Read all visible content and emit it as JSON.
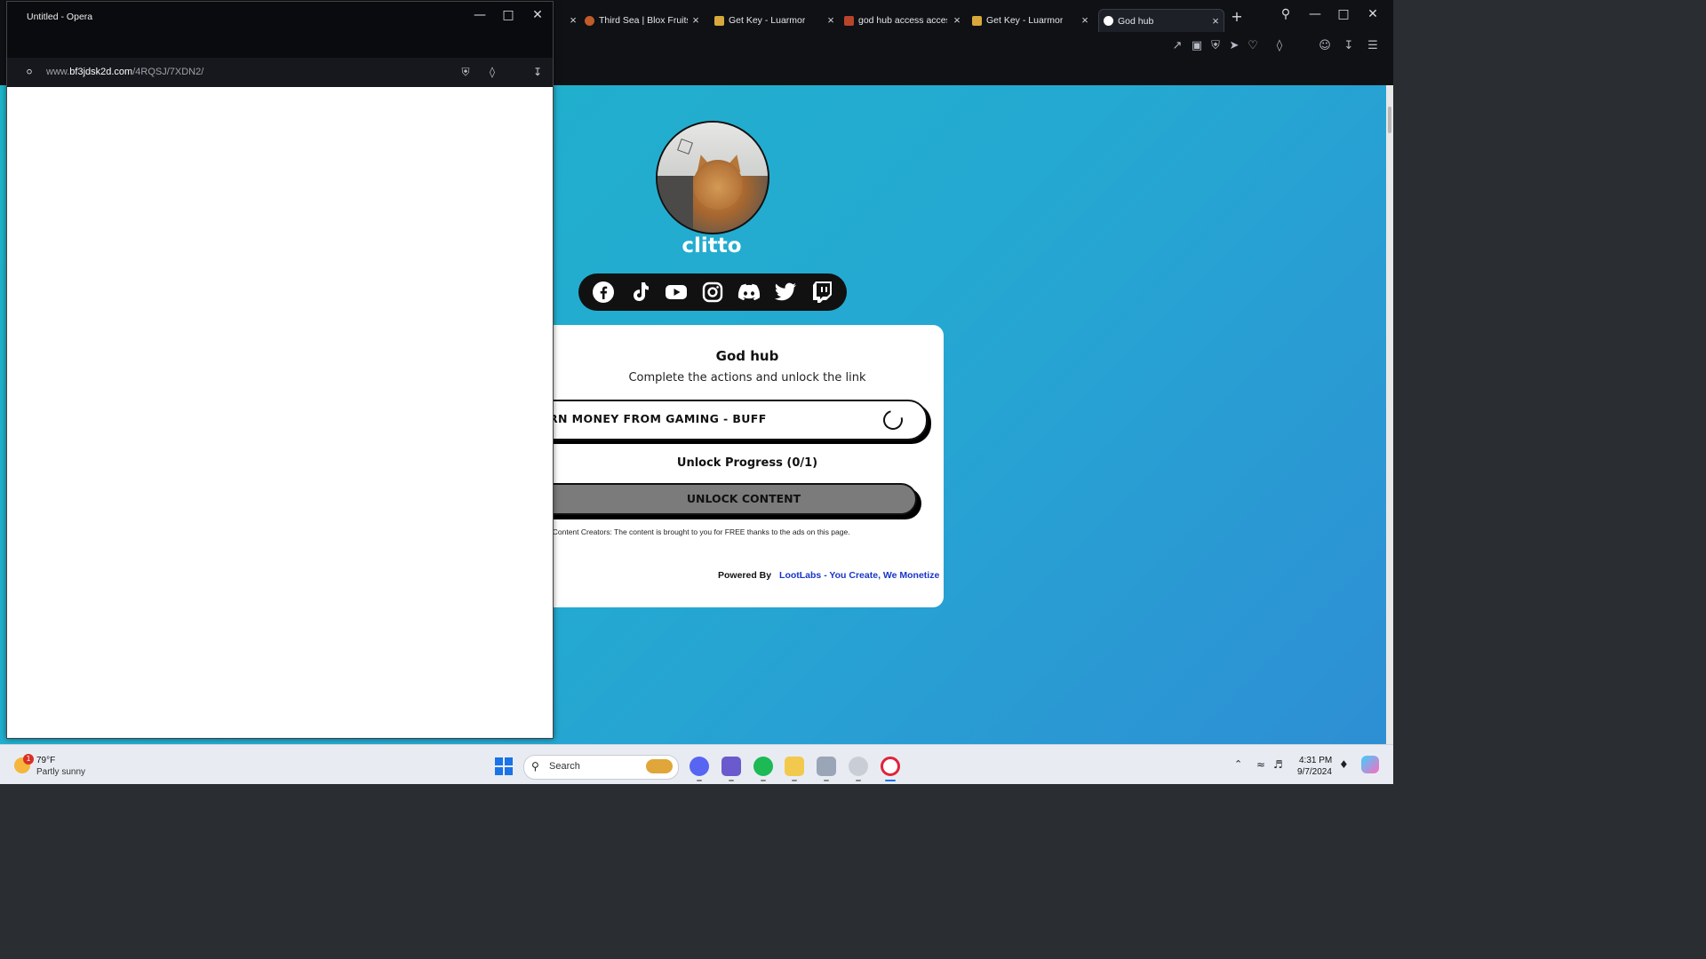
{
  "main_window": {
    "tabs": [
      {
        "label": "",
        "favicon_color": "#5a5e66"
      },
      {
        "label": "Third Sea | Blox Fruits V",
        "favicon_color": "#c25b2a"
      },
      {
        "label": "Get Key - Luarmor",
        "favicon_color": "#d9a83a"
      },
      {
        "label": "god hub access access",
        "favicon_color": "#b8442a"
      },
      {
        "label": "Get Key - Luarmor",
        "favicon_color": "#d9a83a"
      },
      {
        "label": "God hub",
        "favicon_color": "#ffffff"
      }
    ],
    "new_tab_symbol": "+",
    "close_symbol": "×"
  },
  "page": {
    "username": "clitto",
    "social_icons": [
      "facebook-icon",
      "tiktok-icon",
      "youtube-icon",
      "instagram-icon",
      "discord-icon",
      "twitter-icon",
      "twitch-icon"
    ],
    "card": {
      "title": "God hub",
      "subtitle": "Complete the actions and unlock the link",
      "action_label": "RN MONEY FROM GAMING - BUFF",
      "progress_text": "Unlock Progress (0/1)",
      "unlock_label": "UNLOCK CONTENT",
      "support_text": "pport Content Creators: The content is brought to you for FREE thanks to the ads on this page.",
      "powered_by": "Powered By",
      "powered_link": "LootLabs - You Create, We Monetize"
    }
  },
  "popup": {
    "title": "Untitled - Opera",
    "url_prefix": "www.",
    "url_domain": "bf3jdsk2d.com",
    "url_path": "/4RQSJ/7XDN2/"
  },
  "taskbar": {
    "weather_badge": "1",
    "weather_temp": "79°F",
    "weather_desc": "Partly sunny",
    "search_placeholder": "Search",
    "clock_time": "4:31 PM",
    "clock_date": "9/7/2024"
  },
  "colors": {
    "page_gradient_start": "#1eb5c9",
    "page_gradient_end": "#2e8fd4",
    "unlock_button": "#7b7b7b",
    "link": "#1a35c9"
  }
}
